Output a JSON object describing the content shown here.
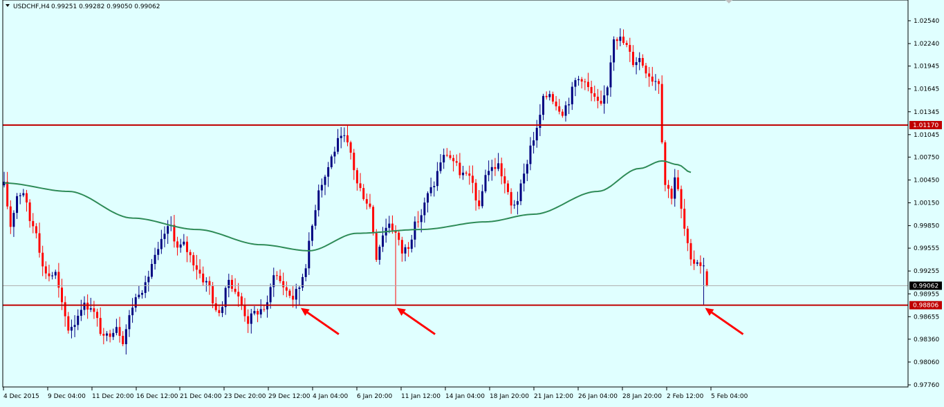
{
  "header": {
    "symbol_label": "USDCHF,H4",
    "ohlc_values": "0.99251 0.99282 0.99050 0.99062"
  },
  "colors": {
    "background": "#e0ffff",
    "axis_border": "#000000",
    "bull_candle": "#000080",
    "bear_candle": "#ff0000",
    "moving_average": "#2e8b57",
    "horizontal_lines": "#c00000",
    "annotation_arrows": "#ff0000",
    "current_price_line": "#b0b0b0"
  },
  "chart_data": {
    "type": "candlestick",
    "title": "USDCHF,H4",
    "timeframe": "H4",
    "ylim": [
      0.9776,
      1.0274
    ],
    "y_ticks": [
      "1.02540",
      "1.02240",
      "1.01945",
      "1.01645",
      "1.01345",
      "1.01045",
      "1.00750",
      "1.00450",
      "1.00150",
      "0.99850",
      "0.99555",
      "0.99255",
      "0.98955",
      "0.98655",
      "0.98360",
      "0.98060",
      "0.97760"
    ],
    "x_ticks": [
      "4 Dec 2015",
      "9 Dec 04:00",
      "11 Dec 20:00",
      "16 Dec 12:00",
      "21 Dec 04:00",
      "23 Dec 20:00",
      "29 Dec 12:00",
      "4 Jan 04:00",
      "6 Jan 20:00",
      "11 Jan 12:00",
      "14 Jan 04:00",
      "18 Jan 20:00",
      "21 Jan 12:00",
      "26 Jan 04:00",
      "28 Jan 20:00",
      "2 Feb 12:00",
      "5 Feb 04:00"
    ],
    "price_path": [
      [
        0,
        1.0038
      ],
      [
        2,
        0.9985
      ],
      [
        4,
        1.0025
      ],
      [
        6,
        1.003
      ],
      [
        8,
        0.9992
      ],
      [
        10,
        0.998
      ],
      [
        12,
        0.993
      ],
      [
        14,
        0.992
      ],
      [
        16,
        0.9922
      ],
      [
        18,
        0.988
      ],
      [
        20,
        0.985
      ],
      [
        22,
        0.9858
      ],
      [
        24,
        0.988
      ],
      [
        27,
        0.988
      ],
      [
        29,
        0.986
      ],
      [
        31,
        0.9835
      ],
      [
        33,
        0.9845
      ],
      [
        35,
        0.9855
      ],
      [
        37,
        0.9835
      ],
      [
        39,
        0.9865
      ],
      [
        40,
        0.988
      ],
      [
        42,
        0.99
      ],
      [
        44,
        0.9905
      ],
      [
        46,
        0.9935
      ],
      [
        48,
        0.995
      ],
      [
        50,
        0.9975
      ],
      [
        52,
        0.9985
      ],
      [
        54,
        0.9955
      ],
      [
        56,
        0.996
      ],
      [
        58,
        0.9945
      ],
      [
        60,
        0.993
      ],
      [
        62,
        0.9915
      ],
      [
        64,
        0.9905
      ],
      [
        66,
        0.987
      ],
      [
        68,
        0.988
      ],
      [
        70,
        0.9915
      ],
      [
        72,
        0.99
      ],
      [
        74,
        0.988
      ],
      [
        76,
        0.986
      ],
      [
        78,
        0.987
      ],
      [
        80,
        0.9875
      ],
      [
        82,
        0.988
      ],
      [
        84,
        0.9925
      ],
      [
        86,
        0.9912
      ],
      [
        88,
        0.99
      ],
      [
        90,
        0.989
      ],
      [
        92,
        0.9905
      ],
      [
        94,
        0.9935
      ],
      [
        96,
        0.9985
      ],
      [
        98,
        1.0035
      ],
      [
        100,
        1.005
      ],
      [
        102,
        1.0075
      ],
      [
        104,
        1.0095
      ],
      [
        106,
        1.01
      ],
      [
        108,
        1.008
      ],
      [
        110,
        1.004
      ],
      [
        112,
        1.0025
      ],
      [
        114,
        1.001
      ],
      [
        116,
        0.9945
      ],
      [
        118,
        0.9975
      ],
      [
        120,
        0.999
      ],
      [
        122,
        0.9975
      ],
      [
        124,
        0.995
      ],
      [
        126,
        0.996
      ],
      [
        128,
        0.9985
      ],
      [
        130,
        1.0
      ],
      [
        132,
        1.0025
      ],
      [
        134,
        1.004
      ],
      [
        136,
        1.007
      ],
      [
        138,
        1.008
      ],
      [
        140,
        1.007
      ],
      [
        142,
        1.0055
      ],
      [
        144,
        1.005
      ],
      [
        146,
        1.004
      ],
      [
        148,
        1.0005
      ],
      [
        150,
        1.0055
      ],
      [
        152,
        1.006
      ],
      [
        154,
        1.0065
      ],
      [
        156,
        1.004
      ],
      [
        158,
        1.001
      ],
      [
        160,
        1.002
      ],
      [
        162,
        1.005
      ],
      [
        164,
        1.009
      ],
      [
        166,
        1.011
      ],
      [
        168,
        1.015
      ],
      [
        170,
        1.016
      ],
      [
        172,
        1.0145
      ],
      [
        174,
        1.0135
      ],
      [
        176,
        1.015
      ],
      [
        178,
        1.0175
      ],
      [
        180,
        1.018
      ],
      [
        182,
        1.0165
      ],
      [
        184,
        1.015
      ],
      [
        186,
        1.014
      ],
      [
        188,
        1.017
      ],
      [
        190,
        1.0235
      ],
      [
        192,
        1.023
      ],
      [
        194,
        1.022
      ],
      [
        196,
        1.02
      ],
      [
        198,
        1.0205
      ],
      [
        200,
        1.019
      ],
      [
        202,
        1.0178
      ],
      [
        204,
        1.0175
      ],
      [
        205,
        1.01
      ],
      [
        206,
        1.004
      ],
      [
        208,
        1.0025
      ],
      [
        209,
        1.005
      ],
      [
        210,
        1.003
      ],
      [
        212,
        0.998
      ],
      [
        214,
        0.9935
      ],
      [
        216,
        0.994
      ],
      [
        218,
        0.993
      ],
      [
        219,
        0.9906
      ]
    ],
    "moving_average": [
      [
        0,
        1.0041
      ],
      [
        20,
        1.003
      ],
      [
        40,
        0.9995
      ],
      [
        60,
        0.998
      ],
      [
        80,
        0.996
      ],
      [
        95,
        0.9952
      ],
      [
        110,
        0.9975
      ],
      [
        130,
        0.998
      ],
      [
        150,
        0.999
      ],
      [
        165,
        1.0
      ],
      [
        185,
        1.003
      ],
      [
        198,
        1.006
      ],
      [
        205,
        1.007
      ],
      [
        210,
        1.0065
      ],
      [
        214,
        1.0055
      ]
    ],
    "horizontal_lines": [
      1.0117,
      0.98806
    ],
    "price_tags": [
      {
        "value": 1.0117,
        "label": "1.01170",
        "style": "level"
      },
      {
        "value": 0.99062,
        "label": "0.99062",
        "style": "current"
      },
      {
        "value": 0.98806,
        "label": "0.98806",
        "style": "level"
      }
    ],
    "arrows": [
      "0.98806 touch near 29 Dec",
      "0.98806 touch near 6 Jan",
      "0.98806 touch near 5 Feb"
    ]
  }
}
